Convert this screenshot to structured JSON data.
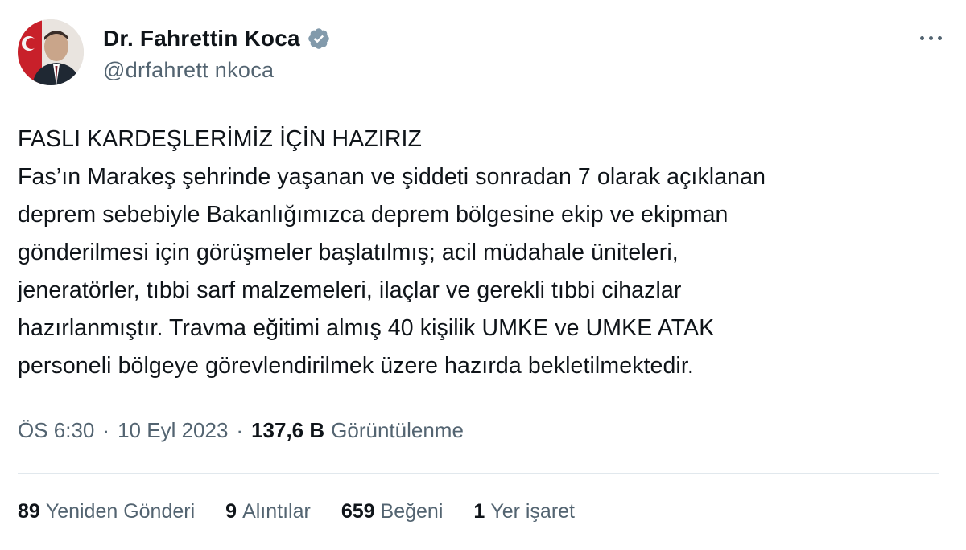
{
  "author": {
    "display_name": "Dr. Fahrettin Koca",
    "handle": "@drfahrett nkoca",
    "verified": true,
    "avatar_icon": "profile-photo"
  },
  "tweet": {
    "text": "FASLI KARDEŞLERİMİZ İÇİN HAZIRIZ\nFas’ın Marakeş şehrinde yaşanan ve şiddeti sonradan 7 olarak açıklanan\ndeprem sebebiyle Bakanlığımızca deprem bölgesine ekip ve ekipman\ngönderilmesi için görüşmeler başlatılmış; acil müdahale üniteleri,\njeneratörler, tıbbi sarf malzemeleri, ilaçlar ve gerekli tıbbi cihazlar\nhazırlanmıştır. Travma eğitimi almış 40 kişilik UMKE ve UMKE ATAK\npersoneli bölgeye görevlendirilmek üzere hazırda bekletilmektedir.",
    "time": "ÖS 6:30",
    "date": "10 Eyl 2023",
    "separator": "·",
    "views_count": "137,6 B",
    "views_label": "Görüntülenme"
  },
  "stats": [
    {
      "count": "89",
      "label": "Yeniden Gönderi"
    },
    {
      "count": "9",
      "label": "Alıntılar"
    },
    {
      "count": "659",
      "label": "Beğeni"
    },
    {
      "count": "1",
      "label": "Yer işaret"
    }
  ],
  "colors": {
    "text": "#0f1419",
    "secondary": "#536471",
    "verified_badge": "#829aab",
    "divider": "#e1e8ed"
  }
}
